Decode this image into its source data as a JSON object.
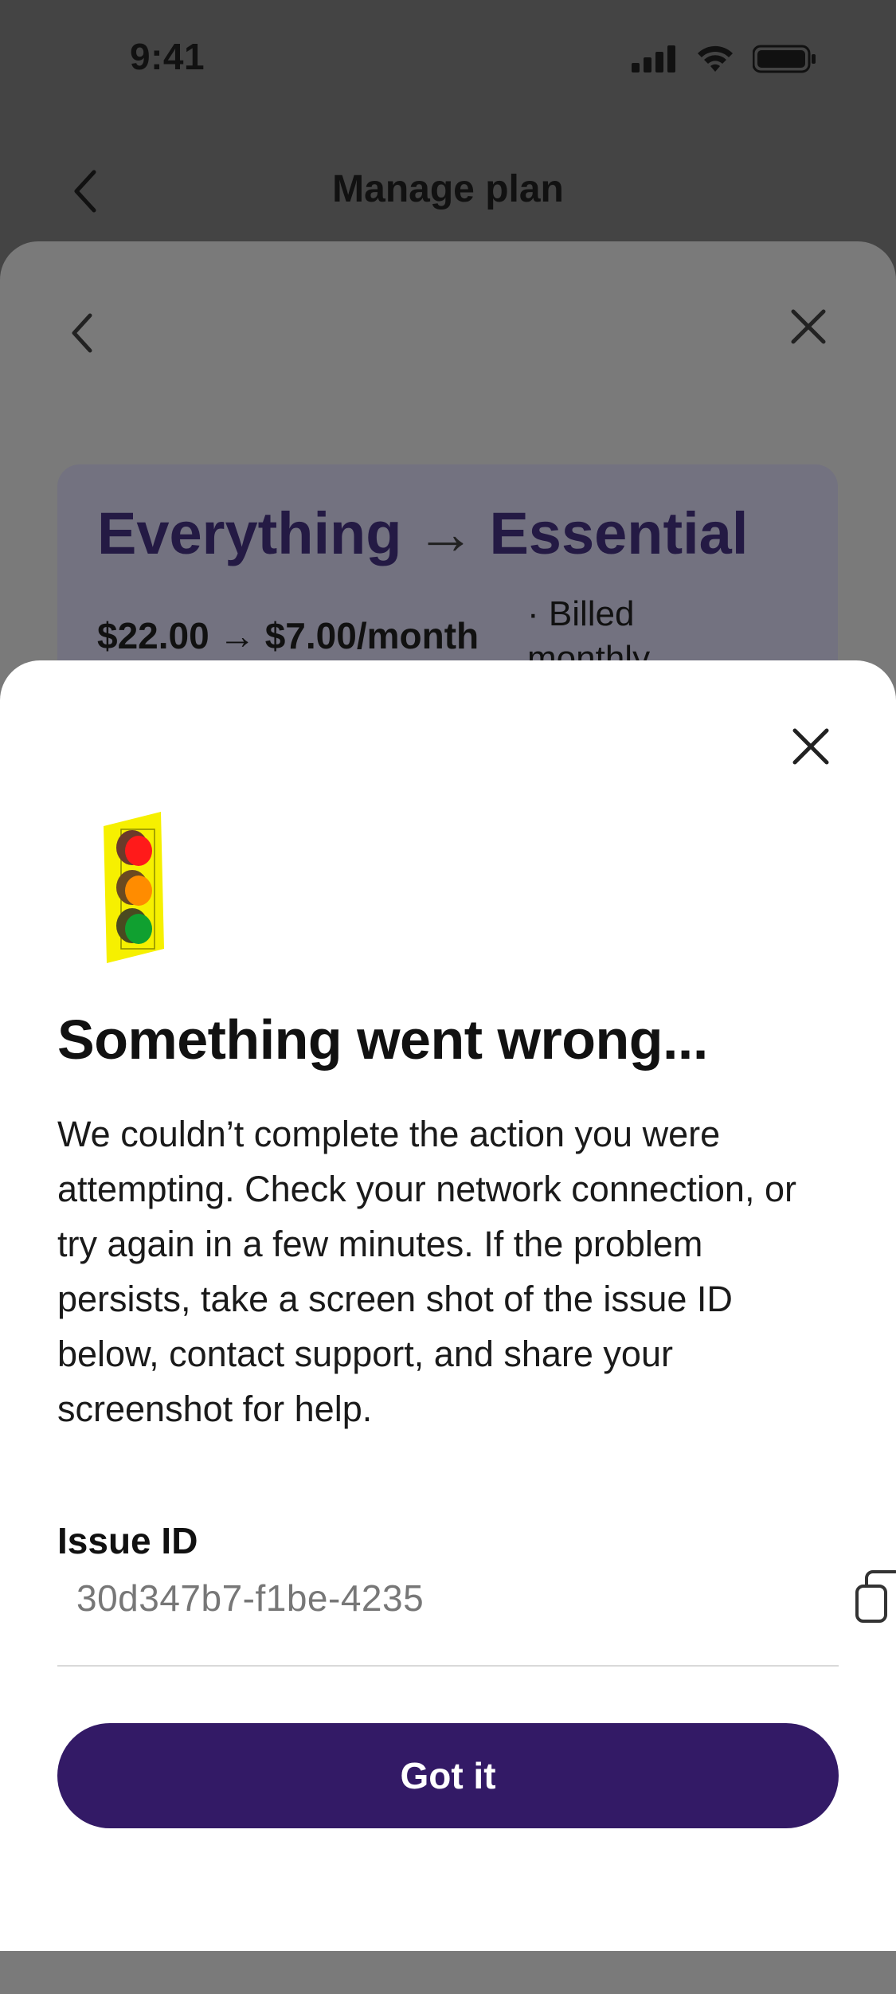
{
  "status_bar": {
    "time": "9:41",
    "icons": [
      "signal-icon",
      "wifi-icon",
      "battery-icon"
    ]
  },
  "header": {
    "title": "Manage plan",
    "back_icon": "chevron-left-icon"
  },
  "background_sheet": {
    "back_icon": "chevron-left-icon",
    "close_icon": "close-icon",
    "plan_from": "Everything",
    "plan_arrow": "→",
    "plan_to": "Essential",
    "price_from": "$22.00",
    "price_arrow": "→",
    "price_to": "$7.00/month",
    "billing": "· Billed monthly"
  },
  "modal": {
    "close_icon": "close-icon",
    "illustration": "traffic-light-icon",
    "title": "Something went wrong...",
    "body": "We couldn’t complete the action you were attempting. Check your network connection, or try again in a few minutes. If the problem persists, take a screen shot of the issue ID below, contact support, and share your screenshot for help.",
    "issue_label": "Issue ID",
    "issue_id": "30d347b7-f1be-4235",
    "copy_icon": "copy-icon",
    "button_label": "Got it"
  },
  "colors": {
    "overlay": "#444444",
    "primary": "#331a66",
    "plan_text": "#241a44"
  }
}
